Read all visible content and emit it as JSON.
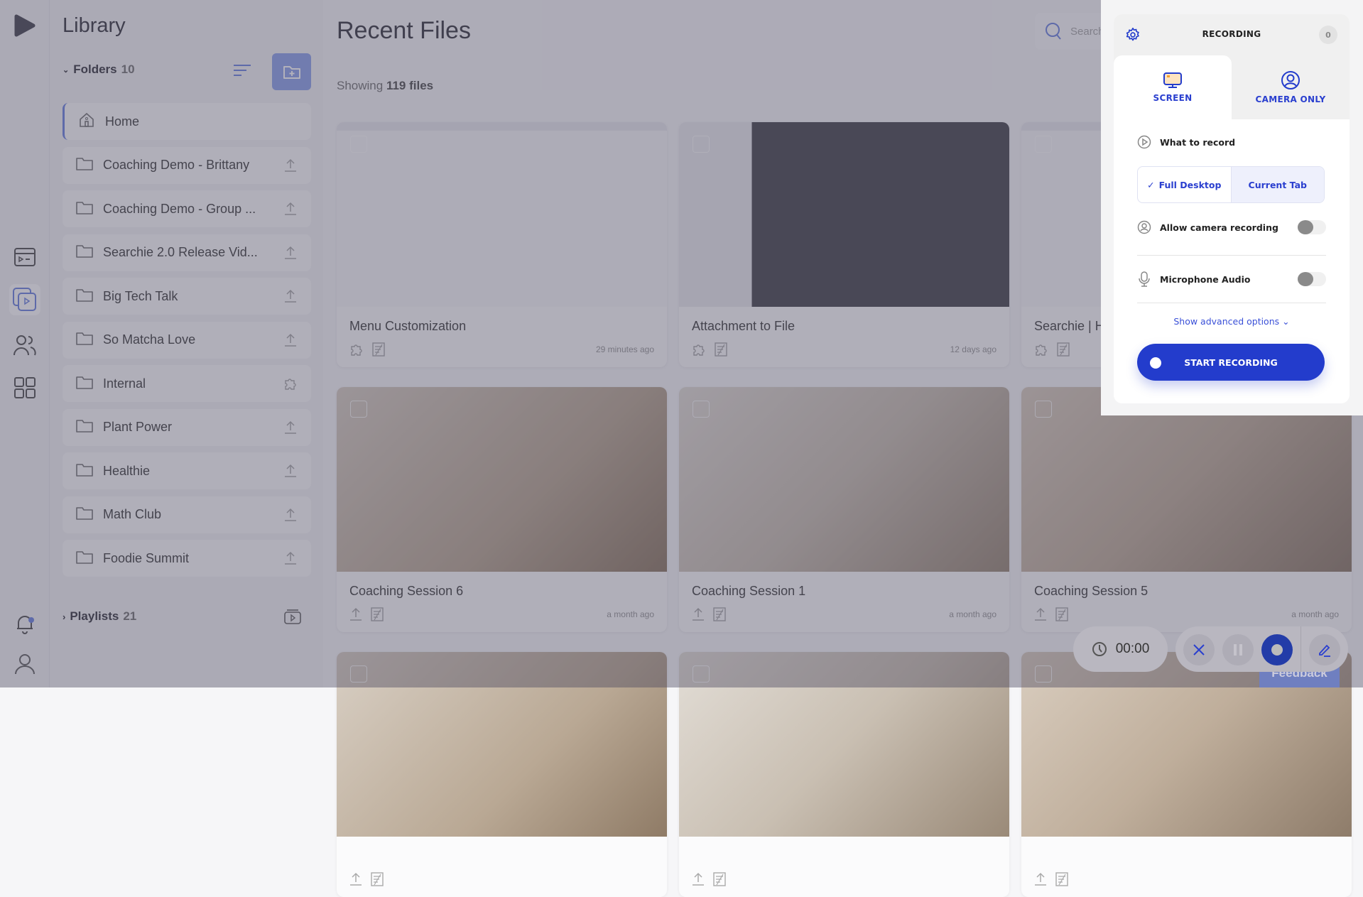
{
  "library": {
    "title": "Library",
    "folders_label": "Folders",
    "folders_count": "10",
    "playlists_label": "Playlists",
    "playlists_count": "21",
    "folders": [
      {
        "name": "Home",
        "icon": "home-icon",
        "action": ""
      },
      {
        "name": "Coaching Demo - Brittany",
        "icon": "folder-icon",
        "action": "upload-icon"
      },
      {
        "name": "Coaching Demo - Group ...",
        "icon": "folder-icon",
        "action": "upload-icon"
      },
      {
        "name": "Searchie 2.0 Release Vid...",
        "icon": "folder-icon",
        "action": "upload-icon"
      },
      {
        "name": "Big Tech Talk",
        "icon": "folder-icon",
        "action": "upload-icon"
      },
      {
        "name": "So Matcha Love",
        "icon": "folder-icon",
        "action": "upload-icon"
      },
      {
        "name": "Internal",
        "icon": "folder-icon",
        "action": "puzzle-icon"
      },
      {
        "name": "Plant Power",
        "icon": "folder-icon",
        "action": "upload-icon"
      },
      {
        "name": "Healthie",
        "icon": "folder-icon",
        "action": "upload-icon"
      },
      {
        "name": "Math Club",
        "icon": "folder-icon",
        "action": "upload-icon"
      },
      {
        "name": "Foodie Summit",
        "icon": "folder-icon",
        "action": "upload-icon"
      }
    ]
  },
  "main": {
    "title": "Recent Files",
    "showing_prefix": "Showing",
    "showing_count": "119 files",
    "search_placeholder": "Search",
    "files": [
      {
        "title": "Menu Customization",
        "time": "29 minutes ago",
        "thumb": "screen"
      },
      {
        "title": "Attachment to File",
        "time": "12 days ago",
        "thumb": "dark"
      },
      {
        "title": "Searchie | Hu",
        "time": "",
        "thumb": "screen"
      },
      {
        "title": "Coaching Session 6",
        "time": "a month ago",
        "thumb": "photo"
      },
      {
        "title": "Coaching Session 1",
        "time": "a month ago",
        "thumb": "photo"
      },
      {
        "title": "Coaching Session 5",
        "time": "a month ago",
        "thumb": "photo"
      },
      {
        "title": "",
        "time": "",
        "thumb": "photo"
      },
      {
        "title": "",
        "time": "",
        "thumb": "photo"
      },
      {
        "title": "",
        "time": "",
        "thumb": "photo"
      }
    ]
  },
  "recorder": {
    "title": "RECORDING",
    "badge": "0",
    "tab_screen": "SCREEN",
    "tab_camera": "CAMERA ONLY",
    "what_label": "What to record",
    "opt_full": "Full Desktop",
    "opt_tab": "Current Tab",
    "camera_label": "Allow camera recording",
    "camera_on": false,
    "mic_label": "Microphone Audio",
    "mic_on": false,
    "advanced": "Show advanced options",
    "start": "START RECORDING",
    "accent": "#233ccc"
  },
  "controls": {
    "timer": "00:00",
    "feedback": "Feedback"
  }
}
